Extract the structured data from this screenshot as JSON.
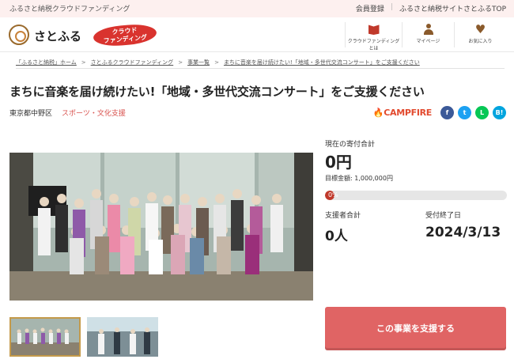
{
  "topbar": {
    "tagline": "ふるさと納税クラウドファンディング",
    "links": [
      "会員登録",
      "ふるさと納税サイトさとふるTOP"
    ]
  },
  "header": {
    "logo_text": "さとふる",
    "badge_line1": "クラウド",
    "badge_line2": "ファンディング",
    "nav": [
      {
        "label": "クラウドファンディングとは",
        "icon": "book-icon"
      },
      {
        "label": "マイページ",
        "icon": "person-icon"
      },
      {
        "label": "お気に入り",
        "icon": "heart-icon"
      }
    ]
  },
  "breadcrumb": [
    "「ふるさと納税」ホーム",
    "さとふるクラウドファンディング",
    "事業一覧",
    "まちに音楽を届け続けたい!「地域・多世代交流コンサート」をご支援ください"
  ],
  "project": {
    "title": "まちに音楽を届け続けたい!「地域・多世代交流コンサート」をご支援ください",
    "area": "東京都中野区",
    "category": "スポーツ・文化支援"
  },
  "share": {
    "partner": "🔥CAMPFIRE",
    "buttons": [
      {
        "name": "facebook",
        "glyph": "f",
        "color": "#3b5998"
      },
      {
        "name": "twitter",
        "glyph": "t",
        "color": "#1da1f2"
      },
      {
        "name": "line",
        "glyph": "L",
        "color": "#06c755"
      },
      {
        "name": "hatena",
        "glyph": "B!",
        "color": "#00a4de"
      }
    ]
  },
  "stats": {
    "current_label": "現在の寄付合計",
    "current_amount": "0円",
    "target_text": "目標金額: 1,000,000円",
    "progress_text": "0%",
    "progress": 0,
    "supporters_label": "支援者合計",
    "supporters_value": "0人",
    "deadline_label": "受付終了日",
    "deadline_value": "2024/3/13"
  },
  "cta": {
    "label": "この事業を支援する"
  },
  "colors": {
    "accent": "#d9332e",
    "cta": "#e06464",
    "topbar": "#fdf0ef"
  }
}
